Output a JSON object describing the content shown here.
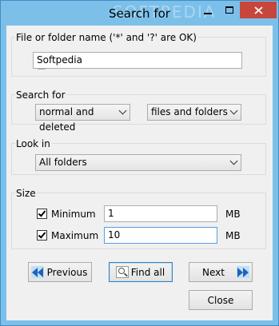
{
  "window": {
    "title": "Search for",
    "watermark": "SOFTPEDIA"
  },
  "name_group": {
    "legend": "File or folder name ('*' and '?' are OK)",
    "value": "Softpedia"
  },
  "search_group": {
    "legend": "Search for",
    "mode_selected": "normal and deleted",
    "type_selected": "files and folders"
  },
  "look_group": {
    "legend": "Look in",
    "selected": "All folders"
  },
  "size_group": {
    "legend": "Size",
    "minimum_label": "Minimum",
    "minimum_value": "1",
    "minimum_unit": "MB",
    "minimum_checked": true,
    "maximum_label": "Maximum",
    "maximum_value": "10",
    "maximum_unit": "MB",
    "maximum_checked": true
  },
  "buttons": {
    "previous": "Previous",
    "find_all": "Find all",
    "next": "Next",
    "close": "Close"
  },
  "colors": {
    "frame": "#7cc0ea",
    "close_button": "#c7463c",
    "client": "#f0f0f0",
    "arrow": "#1f63b5"
  }
}
